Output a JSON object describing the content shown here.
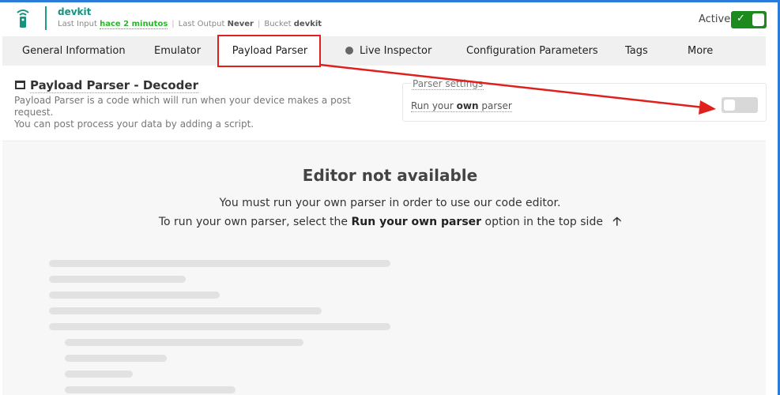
{
  "header": {
    "device_name": "devkit",
    "last_input_label": "Last Input",
    "last_input_value": "hace 2 minutos",
    "last_output_label": "Last Output",
    "last_output_value": "Never",
    "bucket_label": "Bucket",
    "bucket_value": "devkit",
    "active_label": "Active",
    "active_state": true
  },
  "tabs": [
    {
      "label": "General Information"
    },
    {
      "label": "Emulator"
    },
    {
      "label": "Payload Parser",
      "active": true
    },
    {
      "label": "Live Inspector"
    },
    {
      "label": "Configuration Parameters"
    },
    {
      "label": "Tags"
    },
    {
      "label": "More"
    }
  ],
  "content": {
    "title": "Payload Parser - Decoder",
    "desc_line1": "Payload Parser is a code which will run when your device makes a post request.",
    "desc_line2": "You can post process your data by adding a script."
  },
  "settings": {
    "legend": "Parser settings",
    "run_prefix": "Run your",
    "run_bold": "own",
    "run_suffix": "parser",
    "run_enabled": false
  },
  "editor": {
    "title": "Editor not available",
    "line1": "You must run your own parser in order to use our code editor.",
    "line2_prefix": "To run your own parser, select the",
    "line2_bold": "Run your own parser",
    "line2_suffix": "option in the top side"
  },
  "colors": {
    "accent": "#14937f",
    "active_toggle": "#1d8a1d",
    "highlight": "#e0201c"
  }
}
